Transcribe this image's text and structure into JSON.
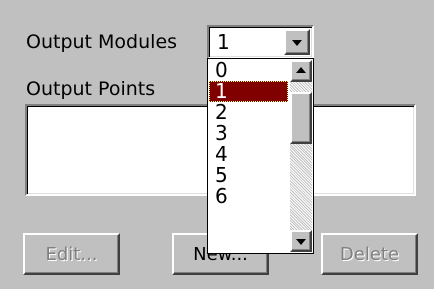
{
  "output_modules": {
    "label": "Output Modules",
    "selected": "1",
    "options": [
      "0",
      "1",
      "2",
      "3",
      "4",
      "5",
      "6"
    ],
    "selected_index": 1,
    "scroll_position": 0.1
  },
  "output_points": {
    "label": "Output Points",
    "items": []
  },
  "buttons": {
    "edit": "Edit...",
    "new": "New...",
    "delete": "Delete"
  },
  "colors": {
    "face": "#c0c0c0",
    "highlight": "#800000",
    "disabled_text": "#808080"
  }
}
